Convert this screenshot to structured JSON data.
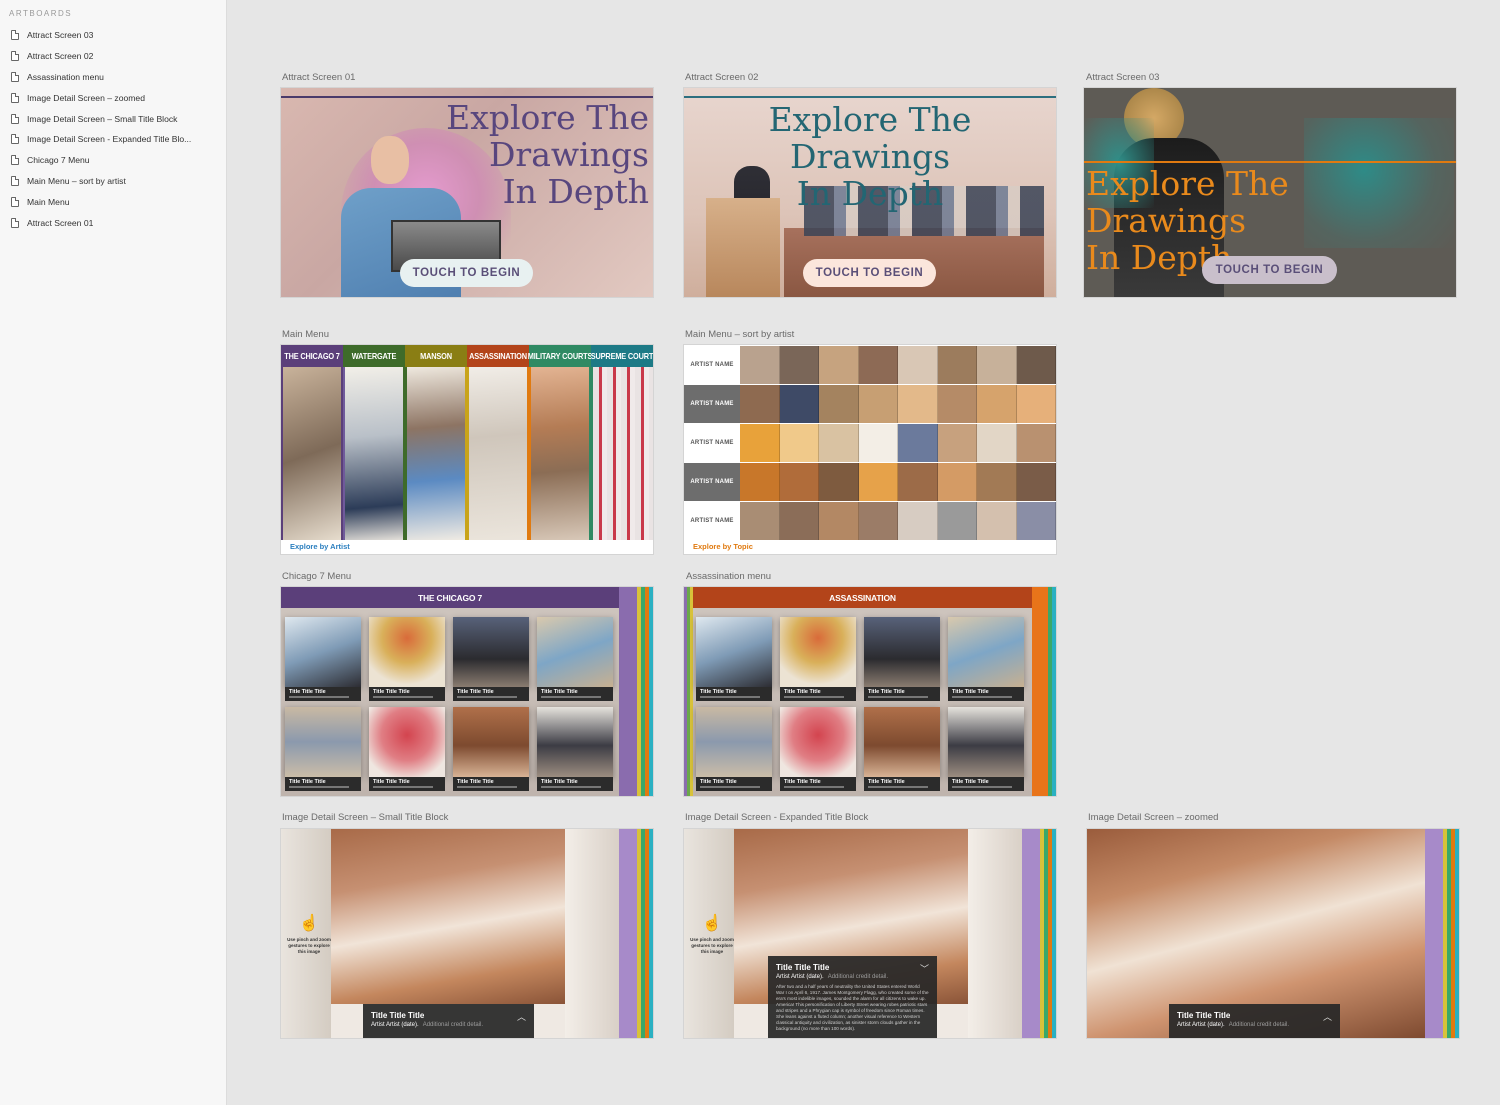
{
  "sidebar": {
    "heading": "ARTBOARDS",
    "items": [
      {
        "label": "Attract Screen 03"
      },
      {
        "label": "Attract Screen 02"
      },
      {
        "label": "Assassination menu"
      },
      {
        "label": "Image Detail Screen – zoomed"
      },
      {
        "label": "Image Detail Screen – Small Title Block"
      },
      {
        "label": "Image Detail Screen - Expanded Title Blo..."
      },
      {
        "label": "Chicago 7 Menu"
      },
      {
        "label": "Main Menu – sort by artist"
      },
      {
        "label": "Main Menu"
      },
      {
        "label": "Attract Screen 01"
      }
    ]
  },
  "artboards": {
    "attract1": {
      "label": "Attract Screen 01",
      "line1": "Explore The Drawings",
      "line2": "In Depth",
      "button": "TOUCH TO BEGIN"
    },
    "attract2": {
      "label": "Attract Screen 02",
      "line1": "Explore The Drawings",
      "line2": "In Depth",
      "button": "TOUCH TO BEGIN"
    },
    "attract3": {
      "label": "Attract Screen 03",
      "line1": "Explore The Drawings",
      "line2": "In Depth",
      "button": "TOUCH TO BEGIN"
    },
    "main_menu": {
      "label": "Main Menu",
      "topics": [
        {
          "name": "THE CHICAGO 7",
          "color": "#5b3f7a"
        },
        {
          "name": "WATERGATE",
          "color": "#3e6b2a"
        },
        {
          "name": "MANSON",
          "color": "#8a7e14"
        },
        {
          "name": "ASSASSINATION",
          "color": "#b3441a"
        },
        {
          "name": "MILITARY COURTS",
          "color": "#2f8a63"
        },
        {
          "name": "SUPREME COURT",
          "color": "#1d7a86"
        }
      ],
      "footer": "Explore by Artist"
    },
    "sort_artist": {
      "label": "Main Menu – sort by artist",
      "rows": [
        "ARTIST NAME",
        "ARTIST NAME",
        "ARTIST NAME",
        "ARTIST NAME",
        "ARTIST NAME"
      ],
      "footer": "Explore by Topic"
    },
    "chicago_menu": {
      "label": "Chicago 7 Menu",
      "bar": "THE CHICAGO 7",
      "tile_title": "Title Title Title"
    },
    "assassination_menu": {
      "label": "Assassination menu",
      "bar": "ASSASSINATION",
      "tile_title": "Title Title Title"
    },
    "detail_small": {
      "label": "Image Detail Screen – Small Title Block",
      "pinch": "Use pinch and zoom gestures to explore this image",
      "title": "Title Title Title",
      "artist": "Artist Artist (date).",
      "credit": "Additional credit detail."
    },
    "detail_expanded": {
      "label": "Image Detail Screen - Expanded Title Block",
      "pinch": "Use pinch and zoom gestures to explore this image",
      "title": "Title Title Title",
      "artist": "Artist Artist (date).",
      "credit": "Additional credit detail.",
      "desc": "After two and a half years of neutrality the United States entered World War I on April 6, 1917. James Montgomery Flagg, who created some of the era's most indelible images, sounded the alarm for all citizens to wake up. America! This personification of Liberty Street wearing robes patriotic stars and stripes and a Phrygian cap is symbol of freedom since Roman times. She leans against a fluted column; another visual reference to Western classical antiquity and civilization, as sinister storm clouds gather in the background (no more than 100 words)."
    },
    "detail_zoomed": {
      "label": "Image Detail Screen – zoomed",
      "title": "Title Title Title",
      "artist": "Artist Artist (date).",
      "credit": "Additional credit detail."
    }
  }
}
